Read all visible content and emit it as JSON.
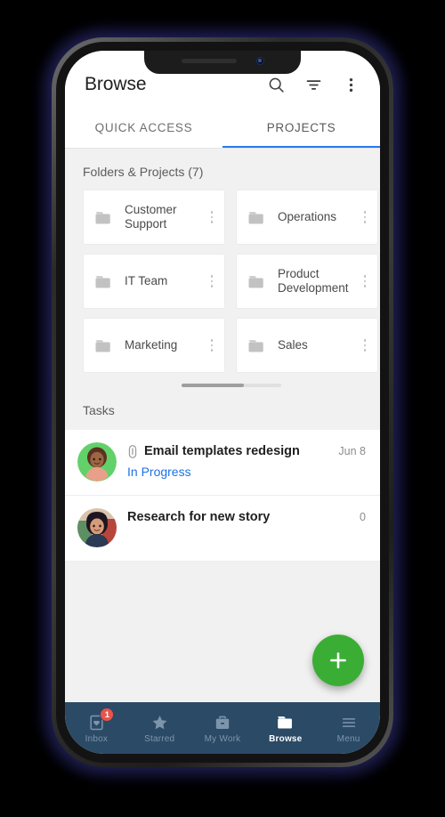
{
  "app": {
    "title": "Browse",
    "actions": [
      {
        "name": "search-icon",
        "label": "Search"
      },
      {
        "name": "filter-icon",
        "label": "Filter"
      },
      {
        "name": "overflow-menu-icon",
        "label": "More options"
      }
    ]
  },
  "tabs": [
    {
      "label": "QUICK ACCESS",
      "active": false
    },
    {
      "label": "PROJECTS",
      "active": true
    }
  ],
  "folders_section": {
    "heading": "Folders & Projects (7)",
    "items": [
      {
        "name": "Customer Support"
      },
      {
        "name": "Operations"
      },
      {
        "name": ""
      },
      {
        "name": "IT Team"
      },
      {
        "name": "Product Development"
      },
      {
        "name": ""
      },
      {
        "name": "Marketing"
      },
      {
        "name": "Sales"
      },
      {
        "name": ""
      }
    ]
  },
  "tasks_section": {
    "heading": "Tasks",
    "items": [
      {
        "title": "Email templates redesign",
        "status": "In Progress",
        "date": "Jun 8",
        "has_attachment": true,
        "avatar_color": "#62d16a"
      },
      {
        "title": "Research for new story",
        "status": "",
        "date": "0",
        "has_attachment": false,
        "avatar_color": "#cbb6a0"
      }
    ]
  },
  "fab": {
    "label": "+",
    "color": "#3aae34"
  },
  "bottom_nav": {
    "items": [
      {
        "label": "Inbox",
        "icon": "inbox-icon",
        "active": false,
        "badge": "1"
      },
      {
        "label": "Starred",
        "icon": "star-icon",
        "active": false,
        "badge": ""
      },
      {
        "label": "My Work",
        "icon": "briefcase-icon",
        "active": false,
        "badge": ""
      },
      {
        "label": "Browse",
        "icon": "folder-icon",
        "active": true,
        "badge": ""
      },
      {
        "label": "Menu",
        "icon": "hamburger-icon",
        "active": false,
        "badge": ""
      }
    ]
  },
  "colors": {
    "accent_blue": "#2979ef",
    "status_blue": "#1b72e8",
    "nav_bg": "#2b4a66",
    "fab_green": "#3aae34",
    "badge_red": "#e8544a"
  }
}
